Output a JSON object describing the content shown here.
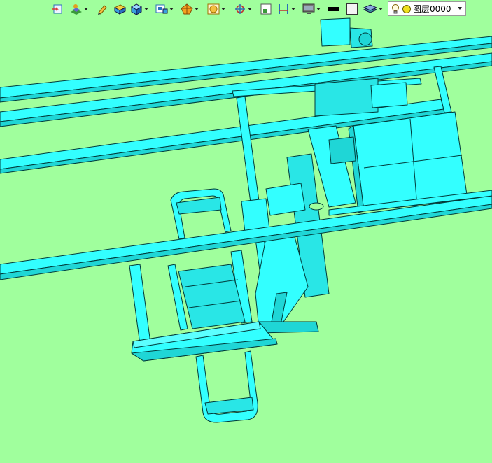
{
  "toolbar": {
    "items": [
      {
        "icon": "open-part-icon",
        "has_dropdown": false
      },
      {
        "icon": "render-style-icon",
        "has_dropdown": true
      },
      {
        "icon": "pencil-icon",
        "has_dropdown": false
      },
      {
        "icon": "layer-box-icon",
        "has_dropdown": false
      },
      {
        "icon": "shaded-cube-icon",
        "has_dropdown": true
      },
      {
        "icon": "view-cube-icon",
        "has_dropdown": true
      },
      {
        "icon": "section-view-icon",
        "has_dropdown": true
      },
      {
        "icon": "zoom-fit-icon",
        "has_dropdown": true
      },
      {
        "icon": "orient-axes-icon",
        "has_dropdown": true
      },
      {
        "icon": "frame-select-icon",
        "has_dropdown": false
      },
      {
        "icon": "dimension-icon",
        "has_dropdown": true
      },
      {
        "icon": "monitor-icon",
        "has_dropdown": true
      },
      {
        "icon": "black-color-icon",
        "has_dropdown": false
      },
      {
        "icon": "white-square-icon",
        "has_dropdown": false
      },
      {
        "icon": "layers-stack-icon",
        "has_dropdown": true
      }
    ],
    "layer": {
      "icons": [
        "lightbulb-icon",
        "yellow-circle-icon"
      ],
      "value": "图层0000"
    }
  },
  "colors": {
    "background": "#a0ff9d",
    "model_fill": "#33ffff",
    "model_edge": "#003a3a"
  }
}
